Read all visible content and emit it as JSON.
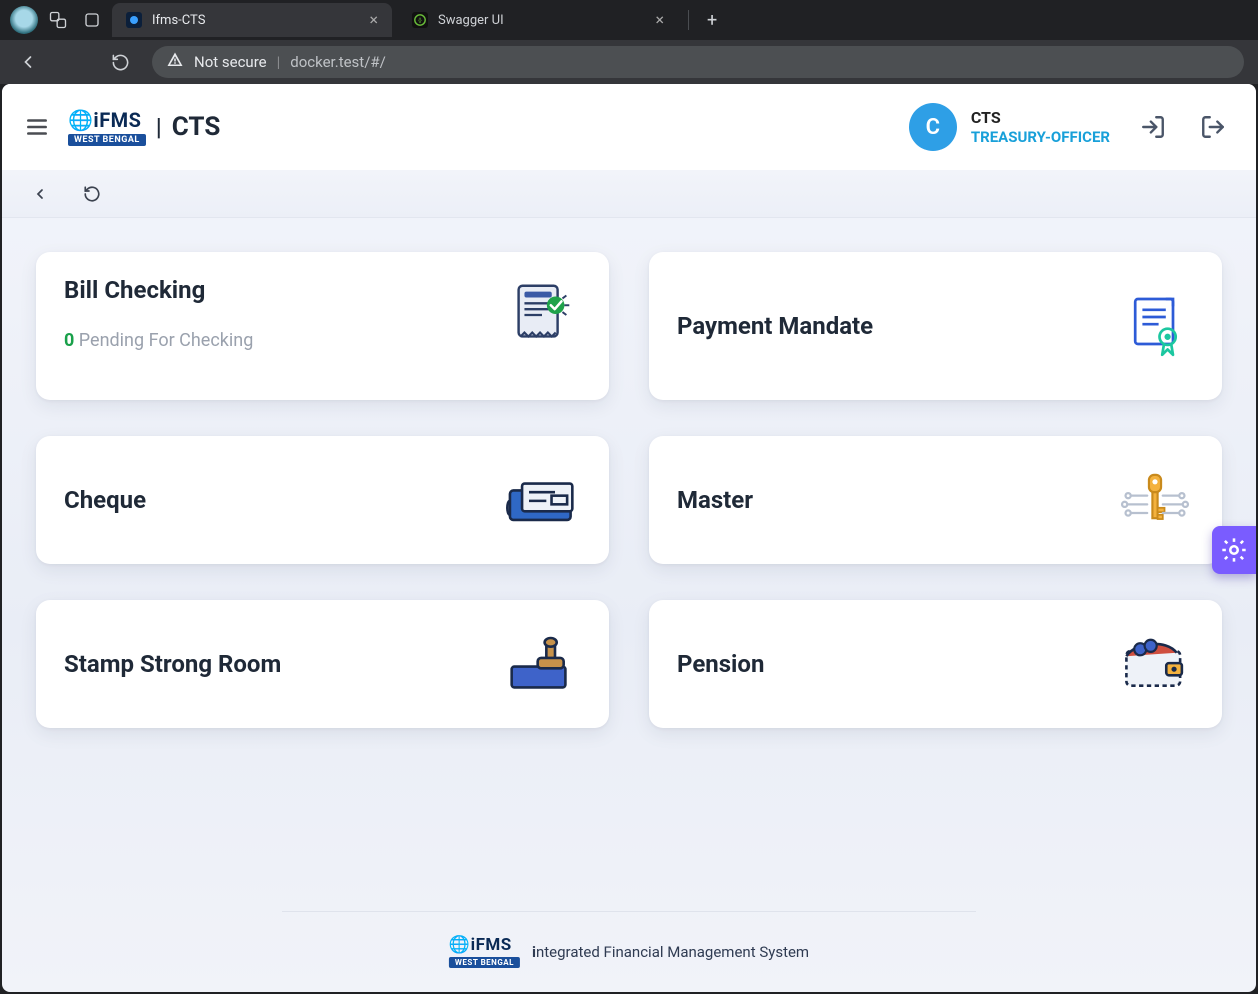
{
  "browser": {
    "tabs": [
      {
        "title": "Ifms-CTS",
        "active": true
      },
      {
        "title": "Swagger UI",
        "active": false
      }
    ],
    "security_label": "Not secure",
    "url": "docker.test/#/"
  },
  "header": {
    "brand_primary": "iFMS",
    "brand_region": "WEST BENGAL",
    "brand_separator": "|",
    "brand_app": "CTS"
  },
  "user": {
    "avatar_initial": "C",
    "name": "CTS",
    "role": "TREASURY-OFFICER"
  },
  "cards": {
    "bill_checking": {
      "title": "Bill Checking",
      "pending_count": "0",
      "pending_label": "Pending For Checking"
    },
    "payment_mandate": {
      "title": "Payment Mandate"
    },
    "cheque": {
      "title": "Cheque"
    },
    "master": {
      "title": "Master"
    },
    "stamp_room": {
      "title": "Stamp Strong Room"
    },
    "pension": {
      "title": "Pension"
    }
  },
  "footer": {
    "text_prefix": "i",
    "text": "ntegrated Financial Management System"
  }
}
